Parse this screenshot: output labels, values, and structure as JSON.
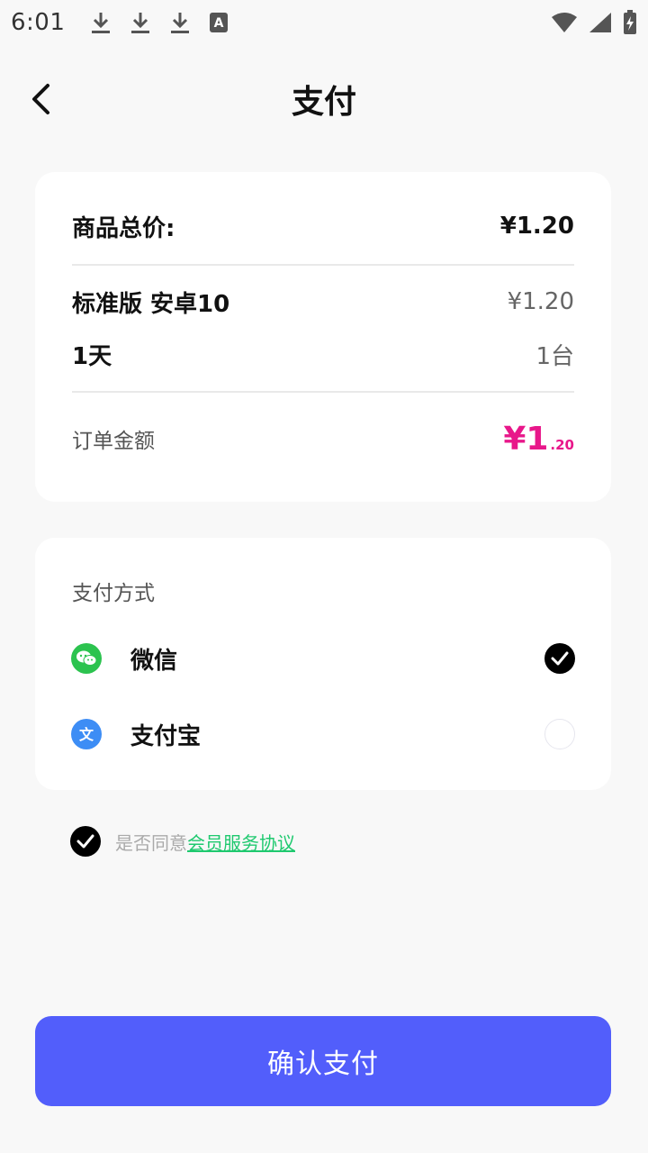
{
  "status_bar": {
    "time": "6:01",
    "icons": [
      "download-icon",
      "download-icon",
      "download-icon",
      "font-a-icon",
      "wifi-icon",
      "signal-icon",
      "battery-charging-icon"
    ]
  },
  "header": {
    "title": "支付",
    "back_icon": "chevron-left-icon"
  },
  "order": {
    "total_label": "商品总价:",
    "total_value": "¥1.20",
    "product_name": "标准版 安卓10",
    "product_price": "¥1.20",
    "duration": "1天",
    "device_count": "1台",
    "amount_label": "订单金额",
    "amount_int": "¥1",
    "amount_dec": ".20"
  },
  "payment": {
    "title": "支付方式",
    "options": [
      {
        "name": "微信",
        "icon": "wechat-icon",
        "selected": true
      },
      {
        "name": "支付宝",
        "icon": "alipay-icon",
        "selected": false
      }
    ]
  },
  "agreement": {
    "prefix": "是否同意",
    "link": "会员服务协议",
    "checked": true
  },
  "confirm": {
    "label": "确认支付"
  },
  "colors": {
    "accent": "#525efb",
    "price": "#e8178a",
    "link": "#1fc96f",
    "wechat": "#2cc34f",
    "alipay": "#3d8df5"
  }
}
